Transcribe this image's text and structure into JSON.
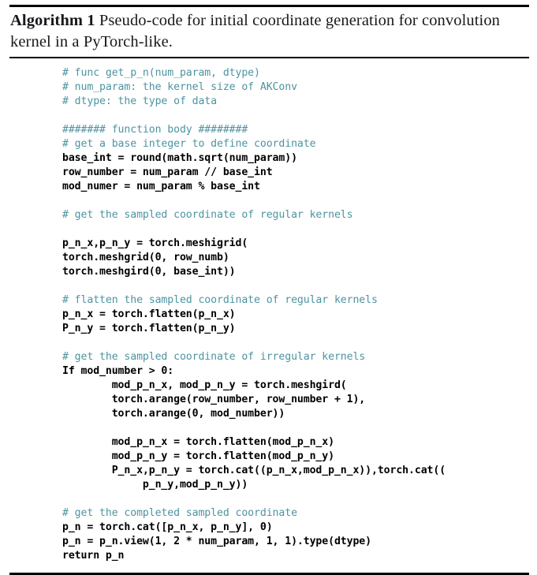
{
  "document": {
    "type": "algorithm-float",
    "caption": {
      "label": "Algorithm",
      "number": "1",
      "title": "Pseudo-code for initial coordinate generation for convolution kernel in a PyTorch-like."
    },
    "colors": {
      "comment": "#4d94a0",
      "code": "#000000",
      "rule": "#000000",
      "background": "#ffffff"
    },
    "code_lines": [
      {
        "kind": "comment",
        "text": "# func get_p_n(num_param, dtype)"
      },
      {
        "kind": "comment",
        "text": "# num_param: the kernel size of AKConv"
      },
      {
        "kind": "comment",
        "text": "# dtype: the type of data"
      },
      {
        "kind": "blank",
        "text": " "
      },
      {
        "kind": "comment",
        "text": "####### function body ########"
      },
      {
        "kind": "comment",
        "text": "# get a base integer to define coordinate"
      },
      {
        "kind": "code",
        "text": "base_int = round(math.sqrt(num_param))"
      },
      {
        "kind": "code",
        "text": "row_number = num_param // base_int"
      },
      {
        "kind": "code",
        "text": "mod_numer = num_param % base_int"
      },
      {
        "kind": "blank",
        "text": " "
      },
      {
        "kind": "comment",
        "text": "# get the sampled coordinate of regular kernels"
      },
      {
        "kind": "blank",
        "text": " "
      },
      {
        "kind": "code",
        "text": "p_n_x,p_n_y = torch.meshigrid("
      },
      {
        "kind": "code",
        "text": "torch.meshgrid(0, row_numb)"
      },
      {
        "kind": "code",
        "text": "torch.meshgird(0, base_int))"
      },
      {
        "kind": "blank",
        "text": " "
      },
      {
        "kind": "comment",
        "text": "# flatten the sampled coordinate of regular kernels"
      },
      {
        "kind": "code",
        "text": "p_n_x = torch.flatten(p_n_x)"
      },
      {
        "kind": "code",
        "text": "P_n_y = torch.flatten(p_n_y)"
      },
      {
        "kind": "blank",
        "text": " "
      },
      {
        "kind": "comment",
        "text": "# get the sampled coordinate of irregular kernels"
      },
      {
        "kind": "code",
        "text": "If mod_number > 0:"
      },
      {
        "kind": "code",
        "text": "        mod_p_n_x, mod_p_n_y = torch.meshgird("
      },
      {
        "kind": "code",
        "text": "        torch.arange(row_number, row_number + 1),"
      },
      {
        "kind": "code",
        "text": "        torch.arange(0, mod_number))"
      },
      {
        "kind": "blank",
        "text": " "
      },
      {
        "kind": "code",
        "text": "        mod_p_n_x = torch.flatten(mod_p_n_x)"
      },
      {
        "kind": "code",
        "text": "        mod_p_n_y = torch.flatten(mod_p_n_y)"
      },
      {
        "kind": "code",
        "text": "        P_n_x,p_n_y = torch.cat((p_n_x,mod_p_n_x)),torch.cat(("
      },
      {
        "kind": "code",
        "text": "             p_n_y,mod_p_n_y))"
      },
      {
        "kind": "blank",
        "text": " "
      },
      {
        "kind": "comment",
        "text": "# get the completed sampled coordinate"
      },
      {
        "kind": "code",
        "text": "p_n = torch.cat([p_n_x, p_n_y], 0)"
      },
      {
        "kind": "code",
        "text": "p_n = p_n.view(1, 2 * num_param, 1, 1).type(dtype)"
      },
      {
        "kind": "code",
        "text": "return p_n"
      }
    ]
  }
}
